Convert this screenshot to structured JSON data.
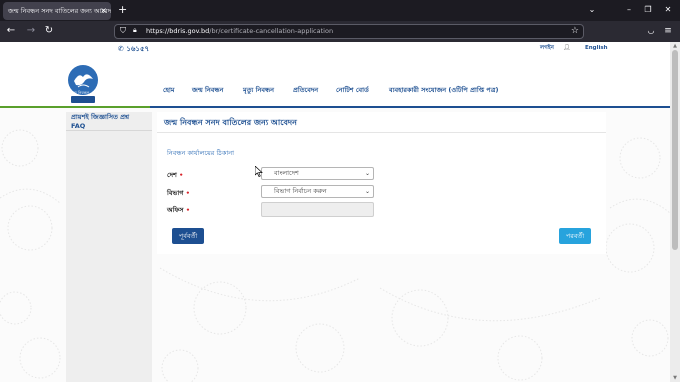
{
  "browser": {
    "tab_title": "জন্ম নিবন্ধন সনদ বাতিলের জন্য আবেদন",
    "tab_close": "×",
    "new_tab": "+",
    "url_host": "https://bdris.gov.bd",
    "url_path": "/br/certificate-cancellation-application",
    "icons": [
      "back-arrow-icon",
      "forward-arrow-icon",
      "reload-icon",
      "shield-icon",
      "lock-icon",
      "star-icon",
      "pocket-icon",
      "menu-icon",
      "list-tabs-icon",
      "minimize-icon",
      "maximize-icon",
      "close-icon"
    ],
    "colors": {
      "tabbar": "#1c1b22",
      "navbar": "#2b2a33"
    }
  },
  "topbar": {
    "hotline": "১৬১৫৭",
    "login": "লগইন",
    "language": "English"
  },
  "header": {
    "logo_caption": "জন্ম নিবন্ধন",
    "menu": [
      "হোম",
      "জন্ম নিবন্ধন",
      "মৃত্যু নিবন্ধন",
      "প্রতিবেদন",
      "নোটিশ বোর্ড",
      "ব্যবহারকারী সংযোজন (ওটিপি প্রাপ্তি পত্র)"
    ]
  },
  "sidebar": {
    "items": [
      "প্রায়শই জিজ্ঞাসিত প্রশ্ন",
      "FAQ"
    ]
  },
  "form": {
    "title": "জন্ম নিবন্ধন সনদ বাতিলের জন্য আবেদন",
    "section_title": "নিবন্ধন কার্যালয়ের ঠিকানা",
    "country_label": "দেশ",
    "country_value": "বাংলাদেশ",
    "division_label": "বিভাগ",
    "division_value": "বিভাগ নির্বাচন করুন",
    "office_label": "অফিস",
    "required_mark": "•",
    "prev_button": "পূর্ববর্তী",
    "next_button": "পরবর্তী"
  },
  "colors": {
    "brand_blue": "#1d4f91",
    "accent_cyan": "#27a3dd",
    "required_red": "#d9232a",
    "accent_green": "#5aa02c"
  }
}
